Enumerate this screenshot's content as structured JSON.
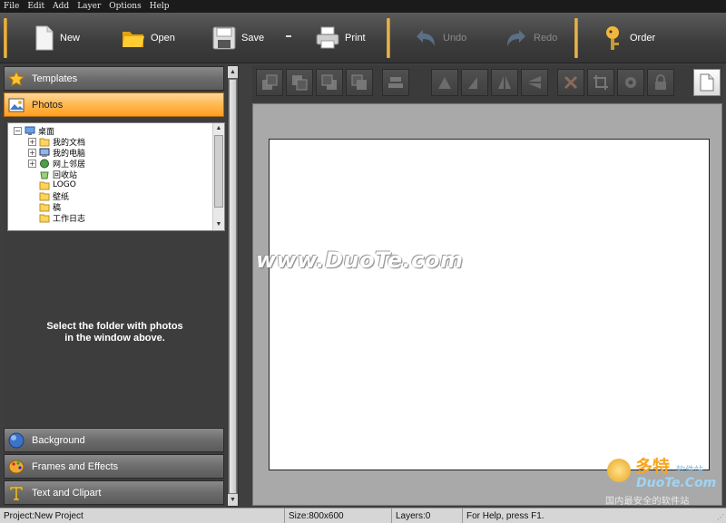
{
  "menu": [
    "File",
    "Edit",
    "Add",
    "Layer",
    "Options",
    "Help"
  ],
  "toolbar": {
    "new": "New",
    "open": "Open",
    "save": "Save",
    "print": "Print",
    "undo": "Undo",
    "redo": "Redo",
    "order": "Order"
  },
  "panel": {
    "templates": "Templates",
    "photos": "Photos",
    "background": "Background",
    "frames": "Frames and Effects",
    "text": "Text and Clipart",
    "hint_line1": "Select the folder with photos",
    "hint_line2": "in the window above."
  },
  "tree": {
    "root": "桌面",
    "items": [
      "我的文档",
      "我的电脑",
      "网上邻居",
      "回收站",
      "LOGO",
      "壁纸",
      "稿",
      "工作日志"
    ]
  },
  "watermark": "www.DuoTe.com",
  "logo": {
    "line1": "多特",
    "line1b": "软件站",
    "line2": "DuoTe.Com",
    "line3": "国内最安全的软件站"
  },
  "status": {
    "project": "Project:New Project",
    "size": "Size:800x600",
    "layers": "Layers:0",
    "help": "For Help, press F1."
  }
}
